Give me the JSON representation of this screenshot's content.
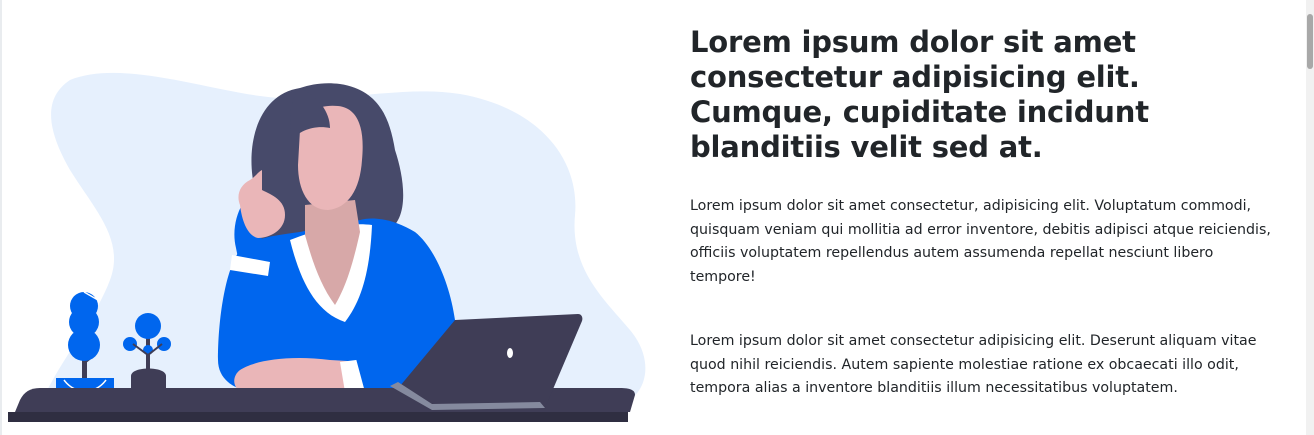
{
  "hero": {
    "headline": "Lorem ipsum dolor sit amet consectetur adipisicing elit. Cumque, cupiditate incidunt blanditiis velit sed at.",
    "paragraph_1": "Lorem ipsum dolor sit amet consectetur, adipisicing elit. Voluptatum commodi, quisquam veniam qui mollitia ad error inventore, debitis adipisci atque reiciendis, officiis voluptatem repellendus autem assumenda repellat nesciunt libero tempore!",
    "paragraph_2": "Lorem ipsum dolor sit amet consectetur adipisicing elit. Deserunt aliquam vitae quod nihil reiciendis. Autem sapiente molestiae ratione ex obcaecati illo odit, tempora alias a inventore blanditiis illum necessitatibus voluptatem."
  },
  "illustration": {
    "icon": "woman-at-laptop-illustration",
    "colors": {
      "blob": "#e6f0fd",
      "desk": "#3f3d56",
      "desk_edge": "#2f2e41",
      "sweater": "#0066ee",
      "hair": "#474a6a",
      "skin": "#eab6b8",
      "laptop": "#3f3d56",
      "plant": "#0066ee"
    }
  },
  "scrollbar": {
    "icon": "vertical-scrollbar"
  }
}
